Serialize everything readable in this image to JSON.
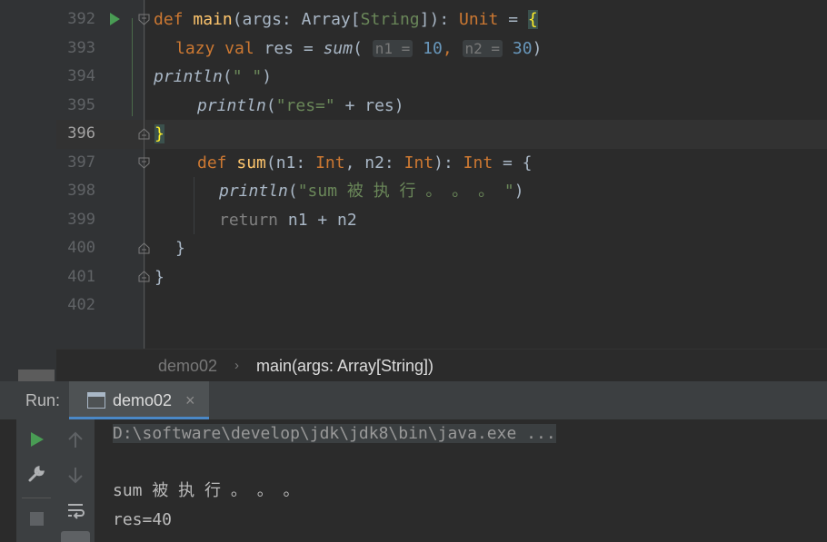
{
  "editor": {
    "current_line": 396,
    "lines": [
      {
        "num": "392"
      },
      {
        "num": "393"
      },
      {
        "num": "394"
      },
      {
        "num": "395"
      },
      {
        "num": "396"
      },
      {
        "num": "397"
      },
      {
        "num": "398"
      },
      {
        "num": "399"
      },
      {
        "num": "400"
      },
      {
        "num": "401"
      },
      {
        "num": "402"
      }
    ],
    "code": {
      "l392": {
        "def": "def ",
        "name": "main",
        "p1": "(args: Array[",
        "type_param": "String",
        "p2": "]): ",
        "ret": "Unit",
        "p3": " = ",
        "brace": "{"
      },
      "l393": {
        "kw": "lazy val ",
        "p1": "res = ",
        "fn": "sum",
        "p2": "( ",
        "hint1": "n1 =",
        "n1": " 10",
        "comma": ", ",
        "hint2": "n2 =",
        "n2": " 30",
        "p3": ")"
      },
      "l394": {
        "fn": "println",
        "p1": "(",
        "str": "\" \"",
        "p2": ")"
      },
      "l395": {
        "fn": "println",
        "p1": "(",
        "str": "\"res=\"",
        "p2": " + res)"
      },
      "l396": {
        "brace": "}"
      },
      "l397": {
        "def": "def ",
        "name": "sum",
        "p1": "(n1: ",
        "t1": "Int",
        "p2": ", n2: ",
        "t2": "Int",
        "p3": "): ",
        "ret": "Int",
        "p4": " = {"
      },
      "l398": {
        "fn": "println",
        "p1": "(",
        "str": "\"sum 被 执 行 。 。 。 \"",
        "p2": ")"
      },
      "l399": {
        "kw": "return",
        "p1": " n1 + n2"
      },
      "l400": {
        "p1": "}"
      },
      "l401": {
        "p1": "}"
      }
    }
  },
  "breadcrumb": {
    "object": "demo02",
    "separator": "›",
    "method": "main(args: Array[String])"
  },
  "run_panel": {
    "label": "Run:",
    "tab_label": "demo02",
    "tab_close": "×",
    "console_lines": [
      "D:\\software\\develop\\jdk\\jdk8\\bin\\java.exe ...",
      "",
      "sum 被 执 行 。 。 。",
      "res=40"
    ]
  },
  "colors": {
    "background": "#2b2b2b",
    "keyword": "#cc7832",
    "function": "#ffc66d",
    "string": "#6a8759",
    "number": "#6897bb",
    "run_green": "#499c54"
  }
}
